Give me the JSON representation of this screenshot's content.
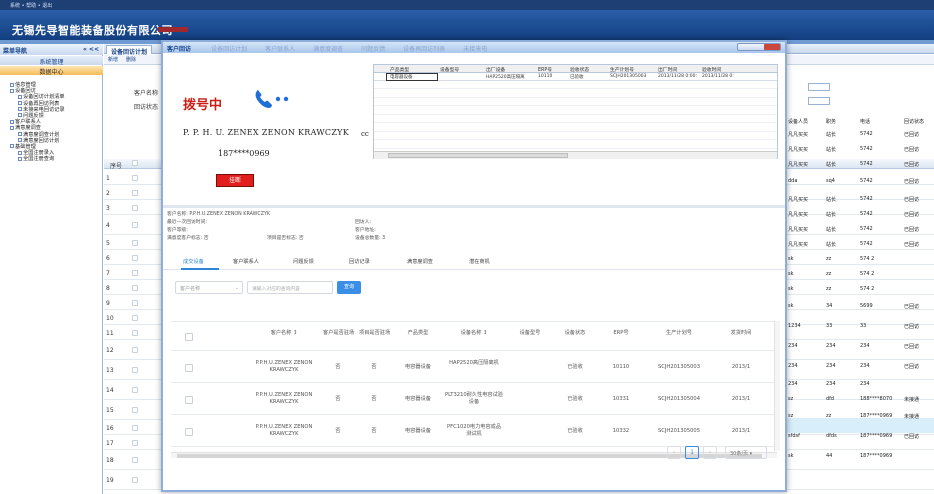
{
  "topbar": {
    "text": "系统 • 帮助 • 退出"
  },
  "app": {
    "company": "无锡先导智能装备股份有限公司"
  },
  "nav": {
    "header": "菜单导航",
    "collapse": "« <<",
    "system": "系统管理",
    "data_center": "数据中心",
    "tree": [
      {
        "level": 1,
        "label": "信息管理"
      },
      {
        "level": 1,
        "label": "设备回访"
      },
      {
        "level": 2,
        "label": "设备回访计划清单"
      },
      {
        "level": 2,
        "label": "设备再回访列表"
      },
      {
        "level": 2,
        "label": "未接来电回访记录"
      },
      {
        "level": 2,
        "label": "问题反馈"
      },
      {
        "level": 1,
        "label": "客户联系人"
      },
      {
        "level": 1,
        "label": "满意度调查"
      },
      {
        "level": 2,
        "label": "满意度调查计划"
      },
      {
        "level": 2,
        "label": "满意度回访计划"
      },
      {
        "level": 1,
        "label": "基础管理"
      },
      {
        "level": 2,
        "label": "全国注册录入"
      },
      {
        "level": 2,
        "label": "全国注册查询"
      }
    ]
  },
  "main": {
    "tab": "设备回访计划",
    "toolbar": [
      "新增",
      "删除"
    ],
    "filter_labels": [
      "客户名称",
      "回访状态"
    ],
    "grid_head": {
      "rownum": "序号"
    },
    "row_numbers": [
      "1",
      "2",
      "3",
      "4",
      "5",
      "6",
      "7",
      "8",
      "9",
      "10",
      "11",
      "12",
      "13",
      "14",
      "15",
      "16",
      "17",
      "18",
      "19",
      "20"
    ],
    "right_cols": {
      "headers": [
        "设备人员",
        "职务",
        "电话",
        "回访状态"
      ],
      "rows": [
        [
          "凡凡买买",
          "站长",
          "5742",
          "已回访"
        ],
        [
          "凡凡买买",
          "站长",
          "5742",
          "已回访"
        ],
        [
          "凡凡买买",
          "站长",
          "5742",
          "已回访"
        ],
        [
          "dda",
          "sq4",
          "5742",
          "已回访"
        ],
        [
          "凡凡买买",
          "站长",
          "5742",
          "已回访"
        ],
        [
          "凡凡买买",
          "站长",
          "5742",
          "已回访"
        ],
        [
          "凡凡买买",
          "站长",
          "5742",
          "已回访"
        ],
        [
          "凡凡买买",
          "站长",
          "5742",
          "已回访"
        ],
        [
          "sk",
          "zz",
          "574 2",
          ""
        ],
        [
          "sk",
          "zz",
          "574 2",
          ""
        ],
        [
          "sk",
          "zz",
          "574 2",
          ""
        ],
        [
          "sk",
          "34",
          "5699",
          "已回访"
        ],
        [
          "1234",
          "33",
          "33",
          "已回访"
        ],
        [
          "234",
          "234",
          "234",
          "已回访"
        ],
        [
          "234",
          "234",
          "234",
          "已回访"
        ],
        [
          "234",
          "234",
          "234",
          ""
        ],
        [
          "sz",
          "dfd",
          "188****8070",
          "未接通"
        ],
        [
          "sz",
          "zz",
          "187****0969",
          "未接通"
        ],
        [
          "sfdsf",
          "dfds",
          "187****0969",
          "已回访"
        ],
        [
          "sk",
          "44",
          "187****0969",
          ""
        ]
      ]
    }
  },
  "dialog": {
    "title": "客户回访",
    "ghost_tabs": [
      "设备回访计划",
      "客户联系人",
      "满意度调查",
      "问题反馈",
      "设备再回访列表",
      "未接来电"
    ],
    "calling": "拨号中",
    "customer": "P. P. H. U. ZENEX ZENON KRAWCZYK",
    "customer_suffix": "cc",
    "phone": "187****0969",
    "hangup": "挂断",
    "mini_headers": [
      "产品类型",
      "设备型号",
      "出厂设备",
      "ERP号",
      "验收状态",
      "生产计划号",
      "出厂时间",
      "验收时间"
    ],
    "mini_row": [
      "电容器设备",
      "",
      "HAP2520高压隔离",
      "10110",
      "已验收",
      "SCJH201305003",
      "2013/11/28 0:00:",
      "2013/11/28 0:"
    ],
    "info": {
      "customer_name": "客户名称: P.P.H.U.ZENEX ZENON KRAWCZYK",
      "last_visit": "最近一次回访时间:",
      "customer_level": "客户等级:",
      "is_top_customer": "满意度客户标志: 否",
      "is_key_project": "项目是否标志: 否",
      "visitor": "回访人:",
      "customer_address": "客户地址:",
      "device_count": "设备总数量: 3"
    },
    "tabs": [
      "成交设备",
      "客户联系人",
      "问题反馈",
      "回访记录",
      "满意度调查",
      "潜在商机"
    ],
    "search": {
      "select": "客户名称",
      "placeholder": "请输入对应的查询内容",
      "button": "查询"
    },
    "table": {
      "headers": [
        "客户名称 ↕",
        "客户是否驻场",
        "项目是否驻场",
        "产品类型",
        "设备名称 ↕",
        "设备型号",
        "设备状态",
        "ERP号",
        "生产计划号",
        "发货时间"
      ],
      "rows": [
        {
          "customer": "P.P.H.U.ZENEX ZENON KRAWCZYK",
          "onsite_customer": "否",
          "onsite_project": "否",
          "product_type": "电容器设备",
          "device_name": "HAP2520高压隔离机",
          "model": "",
          "status": "已验收",
          "erp": "10110",
          "plan": "SCJH201305003",
          "ship": "2013/1"
        },
        {
          "customer": "P.P.H.U.ZENEX ZENON KRAWCZYK",
          "onsite_customer": "否",
          "onsite_project": "否",
          "product_type": "电容器设备",
          "device_name": "PLT3210耐久性电容试验设备",
          "model": "",
          "status": "已验收",
          "erp": "10331",
          "plan": "SCJH201305004",
          "ship": "2013/1"
        },
        {
          "customer": "P.P.H.U.ZENEX ZENON KRAWCZYK",
          "onsite_customer": "否",
          "onsite_project": "否",
          "product_type": "电容器设备",
          "device_name": "PFC1020电力电容成品测试机",
          "model": "",
          "status": "已验收",
          "erp": "10332",
          "plan": "SCJH201305005",
          "ship": "2013/1"
        }
      ]
    },
    "pager": {
      "prev": "‹",
      "page": "1",
      "next": "›",
      "size": "30条/页 ▾"
    }
  },
  "colors": {
    "accent": "#2f86d4",
    "danger": "#e11d1d",
    "title_blue": "#1d4f96"
  }
}
